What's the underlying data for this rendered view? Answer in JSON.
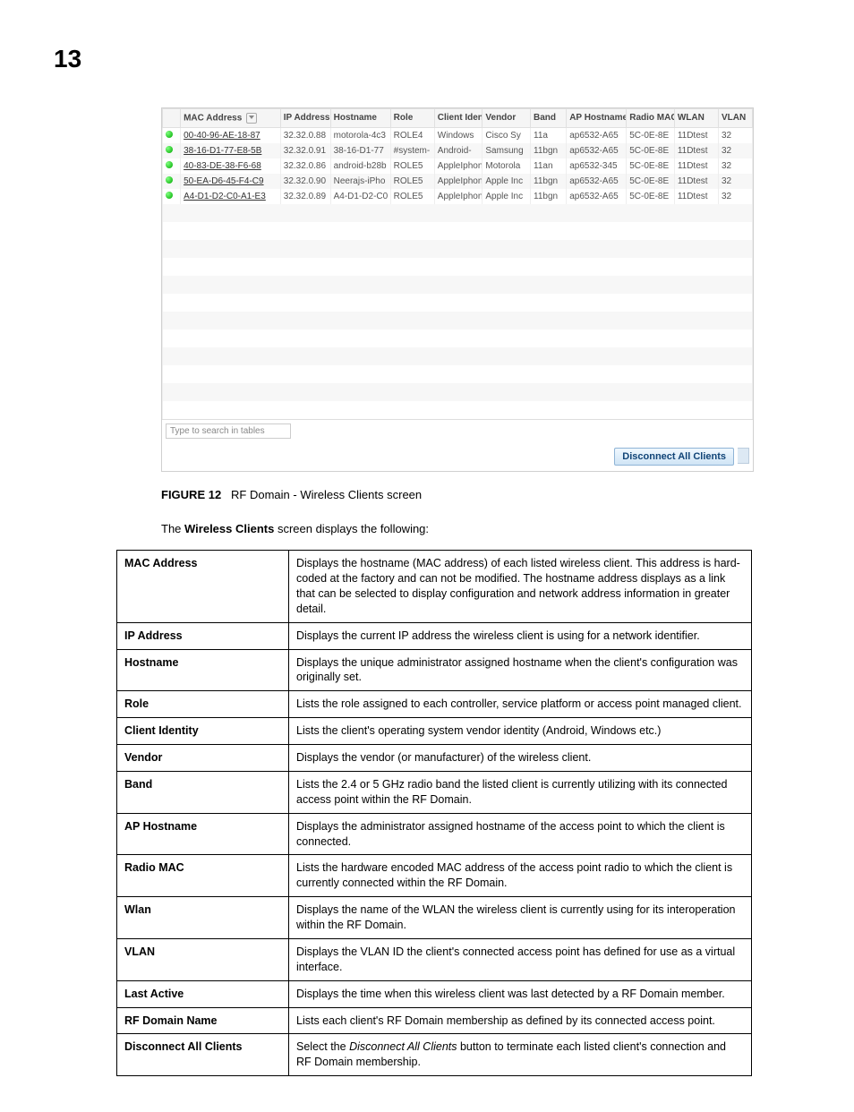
{
  "page_number": "13",
  "screenshot": {
    "headers": [
      "",
      "MAC Address",
      "IP Address",
      "Hostname",
      "Role",
      "Client Identity",
      "Vendor",
      "Band",
      "AP Hostname",
      "Radio MAC",
      "WLAN",
      "VLAN"
    ],
    "search_placeholder": "Type to search in tables",
    "disconnect_label": "Disconnect All Clients",
    "rows": [
      {
        "mac": "00-40-96-AE-18-87",
        "ip": "32.32.0.88",
        "host": "motorola-4c3",
        "role": "ROLE4",
        "ci": "Windows",
        "vendor": "Cisco Sy",
        "band": "11a",
        "aphost": "ap6532-A65",
        "rmac": "5C-0E-8E",
        "wlan": "11Dtest",
        "vlan": "32"
      },
      {
        "mac": "38-16-D1-77-E8-5B",
        "ip": "32.32.0.91",
        "host": "38-16-D1-77",
        "role": "#system-",
        "ci": "Android-",
        "vendor": "Samsung",
        "band": "11bgn",
        "aphost": "ap6532-A65",
        "rmac": "5C-0E-8E",
        "wlan": "11Dtest",
        "vlan": "32"
      },
      {
        "mac": "40-83-DE-38-F6-68",
        "ip": "32.32.0.86",
        "host": "android-b28b",
        "role": "ROLE5",
        "ci": "AppleIphone",
        "vendor": "Motorola",
        "band": "11an",
        "aphost": "ap6532-345",
        "rmac": "5C-0E-8E",
        "wlan": "11Dtest",
        "vlan": "32"
      },
      {
        "mac": "50-EA-D6-45-F4-C9",
        "ip": "32.32.0.90",
        "host": "Neerajs-iPho",
        "role": "ROLE5",
        "ci": "AppleIphone",
        "vendor": "Apple Inc",
        "band": "11bgn",
        "aphost": "ap6532-A65",
        "rmac": "5C-0E-8E",
        "wlan": "11Dtest",
        "vlan": "32"
      },
      {
        "mac": "A4-D1-D2-C0-A1-E3",
        "ip": "32.32.0.89",
        "host": "A4-D1-D2-C0",
        "role": "ROLE5",
        "ci": "AppleIphone",
        "vendor": "Apple Inc",
        "band": "11bgn",
        "aphost": "ap6532-A65",
        "rmac": "5C-0E-8E",
        "wlan": "11Dtest",
        "vlan": "32"
      }
    ]
  },
  "figure": {
    "label": "FIGURE 12",
    "caption": "RF Domain - Wireless Clients screen"
  },
  "intro": {
    "pre": "The ",
    "bold": "Wireless Clients",
    "post": " screen displays the following:"
  },
  "defs": [
    {
      "term": "MAC Address",
      "desc": "Displays the hostname (MAC address) of each listed wireless client. This address is hard-coded at the factory and can not be modified. The hostname address displays as a link that can be selected to display configuration and network address information in greater detail."
    },
    {
      "term": "IP Address",
      "desc": "Displays the current IP address the wireless client is using for a network identifier."
    },
    {
      "term": "Hostname",
      "desc": "Displays the unique administrator assigned hostname when the client's configuration was originally set."
    },
    {
      "term": "Role",
      "desc": "Lists the role assigned to each controller, service platform or access point managed client."
    },
    {
      "term": "Client Identity",
      "desc": "Lists the client's operating system vendor identity (Android, Windows etc.)"
    },
    {
      "term": "Vendor",
      "desc": "Displays the vendor (or manufacturer) of the wireless client."
    },
    {
      "term": "Band",
      "desc": "Lists the 2.4 or 5 GHz radio band the listed client is currently utilizing with its connected access point within the RF Domain."
    },
    {
      "term": "AP Hostname",
      "desc": "Displays the administrator assigned hostname of the access point to which the client is connected."
    },
    {
      "term": "Radio MAC",
      "desc": "Lists the hardware encoded MAC address of the access point radio to which the client is currently connected within the RF Domain."
    },
    {
      "term": "Wlan",
      "desc": "Displays the name of the WLAN the wireless client is currently using for its interoperation within the RF Domain."
    },
    {
      "term": "VLAN",
      "desc": "Displays the VLAN ID the client's connected access point has defined for use as a virtual interface."
    },
    {
      "term": "Last Active",
      "desc": "Displays the time when this wireless client was last detected by a RF Domain member."
    },
    {
      "term": "RF Domain Name",
      "desc": "Lists each client's RF Domain membership as defined by its connected access point."
    },
    {
      "term": "Disconnect All Clients",
      "desc_pre": "Select the ",
      "desc_italic": "Disconnect All Clients",
      "desc_post": " button to terminate each listed client's connection and RF Domain membership."
    }
  ]
}
